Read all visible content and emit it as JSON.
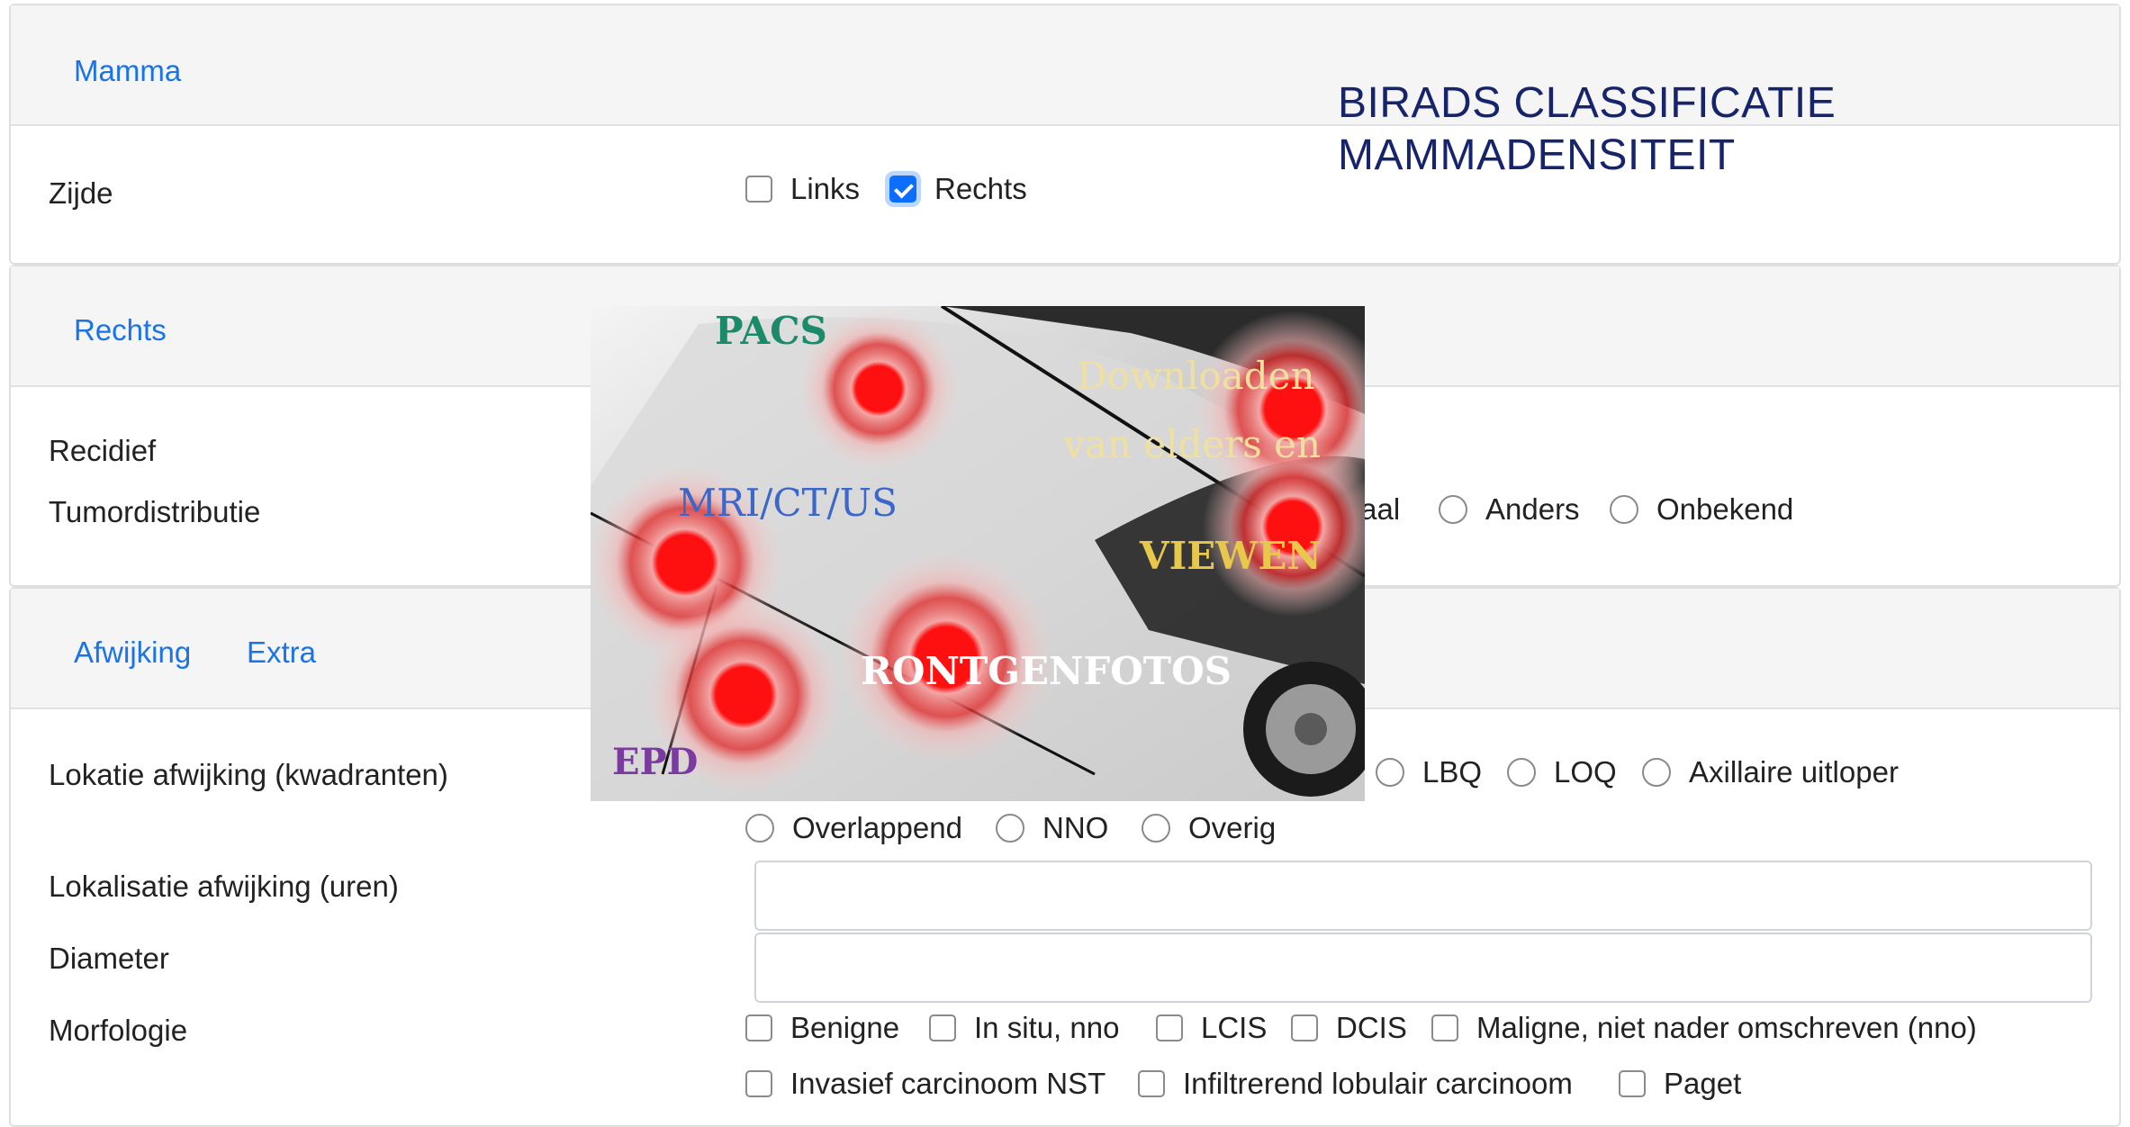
{
  "mamma_card": {
    "tab": "Mamma",
    "zijde_label": "Zijde",
    "options": [
      {
        "label": "Links",
        "checked": false
      },
      {
        "label": "Rechts",
        "checked": true
      }
    ]
  },
  "overlay_heading": {
    "line1": "BIRADS CLASSIFICATIE",
    "line2": "MAMMADENSITEIT"
  },
  "rechts_card": {
    "tab": "Rechts",
    "recidief_label": "Recidief",
    "tumordistributie_label": "Tumordistributie",
    "tumordistributie_options_visible": [
      "taal",
      "Anders",
      "Onbekend"
    ]
  },
  "afwijking_card": {
    "tabs": [
      "Afwijking",
      "Extra"
    ],
    "lokatie_label": "Lokatie afwijking (kwadranten)",
    "lokatie_options_row1": [
      "LBQ",
      "LOQ",
      "Axillaire uitloper"
    ],
    "lokatie_options_row2": [
      "Overlappend",
      "NNO",
      "Overig"
    ],
    "lokalisatie_label": "Lokalisatie afwijking (uren)",
    "lokalisatie_value": "",
    "diameter_label": "Diameter",
    "diameter_value": "",
    "morfologie_label": "Morfologie",
    "morfologie_row1": [
      "Benigne",
      "In situ, nno",
      "LCIS",
      "DCIS",
      "Maligne, niet nader omschreven (nno)"
    ],
    "morfologie_row2": [
      "Invasief carcinoom NST",
      "Infiltrerend lobulair carcinoom",
      "Paget"
    ]
  },
  "ad_image": {
    "pacs": "PACS",
    "mri": "MRI/CT/US",
    "downloaden": "Downloaden",
    "van_elders": "van elders en",
    "viewen": "VIEWEN",
    "rontgen": "RONTGENFOTOS",
    "epd": "EPD"
  }
}
